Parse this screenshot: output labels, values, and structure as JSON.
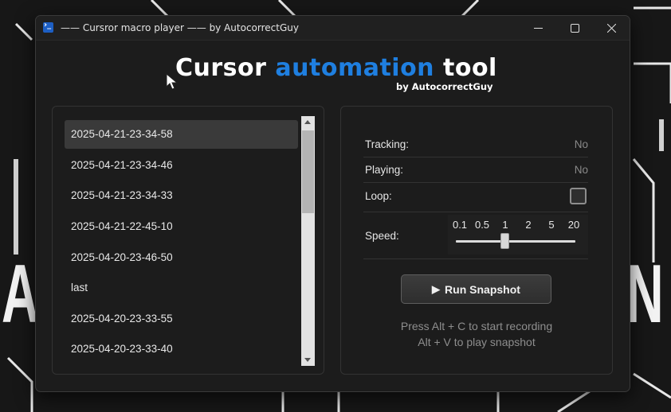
{
  "background": {
    "letters": [
      "A",
      "N"
    ]
  },
  "window": {
    "title": "—— Cursror macro player —— by AutocorrectGuy",
    "app_icon": "powershell-icon",
    "controls": [
      "minimize-icon",
      "maximize-icon",
      "close-icon"
    ]
  },
  "header": {
    "logo_word1": "Cursor",
    "logo_word2": "automation",
    "logo_word3": "tool",
    "logo_sub": "by AutocorrectGuy",
    "accent_color": "#1f7fe0"
  },
  "list": {
    "selected_index": 0,
    "items": [
      "2025-04-21-23-34-58",
      "2025-04-21-23-34-46",
      "2025-04-21-23-34-33",
      "2025-04-21-22-45-10",
      "2025-04-20-23-46-50",
      "last",
      "2025-04-20-23-33-55",
      "2025-04-20-23-33-40"
    ]
  },
  "controls": {
    "tracking_label": "Tracking:",
    "tracking_value": "No",
    "playing_label": "Playing:",
    "playing_value": "No",
    "loop_label": "Loop:",
    "loop_checked": false,
    "speed_label": "Speed:",
    "speed_ticks": [
      "0.1",
      "0.5",
      "1",
      "2",
      "5",
      "20"
    ],
    "speed_value": "1",
    "run_button_icon": "play-icon",
    "run_button_label": "Run Snapshot",
    "hint_line1": "Press Alt + C to start recording",
    "hint_line2": "Alt + V to play snapshot"
  }
}
